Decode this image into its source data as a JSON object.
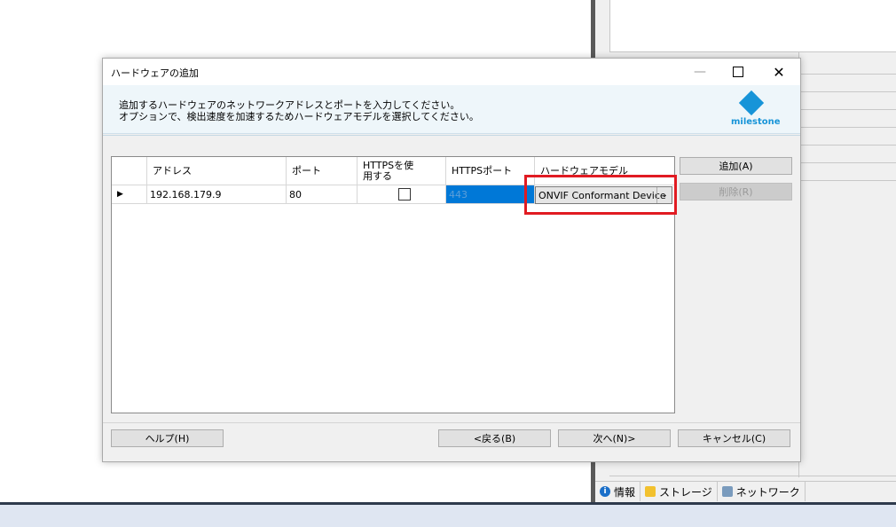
{
  "dialog": {
    "title": "ハードウェアの追加",
    "window_controls": {
      "minimize": "—",
      "close": "✕"
    },
    "instructions": [
      "追加するハードウェアのネットワークアドレスとポートを入力してください。",
      "オプションで、検出速度を加速するためハードウェアモデルを選択してください。"
    ],
    "logo_text": "milestone",
    "grid": {
      "columns": [
        "",
        "アドレス",
        "ポート",
        "HTTPSを使用する",
        "HTTPSポート",
        "ハードウェアモデル"
      ],
      "rows": [
        {
          "indicator": "▶",
          "address": "192.168.179.9",
          "port": "80",
          "use_https": false,
          "https_port": "443",
          "model": "ONVIF Conformant Device"
        }
      ]
    },
    "side_buttons": {
      "add": "追加(A)",
      "remove": "削除(R)"
    },
    "footer_buttons": {
      "help": "ヘルプ(H)",
      "back": "<戻る(B)",
      "next": "次へ(N)>",
      "cancel": "キャンセル(C)"
    }
  },
  "background": {
    "tabs": [
      {
        "label": "情報",
        "icon": "info-icon"
      },
      {
        "label": "ストレージ",
        "icon": "storage-icon"
      },
      {
        "label": "ネットワーク",
        "icon": "network-icon"
      }
    ]
  },
  "colors": {
    "accent": "#0078d7",
    "highlight_border": "#e11b22",
    "brand": "#1794d8"
  }
}
